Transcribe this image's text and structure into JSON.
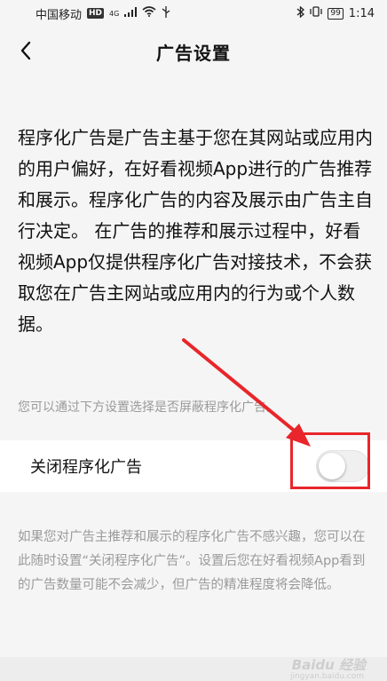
{
  "status_bar": {
    "carrier": "中国移动",
    "hd_badge": "HD",
    "network": "4G",
    "battery": "99",
    "time": "1:14"
  },
  "header": {
    "title": "广告设置"
  },
  "intro_text": "程序化广告是广告主基于您在其网站或应用内的用户偏好，在好看视频App进行的广告推荐和展示。程序化广告的内容及展示由广告主自行决定。 在广告的推荐和展示过程中，好看视频App仅提供程序化广告对接技术，不会获取您在广告主网站或应用内的行为或个人数据。",
  "hint_text": "您可以通过下方设置选择是否屏蔽程序化广告。",
  "toggle": {
    "label": "关闭程序化广告",
    "enabled": false
  },
  "description_text": "如果您对广告主推荐和展示的程序化广告不感兴趣，您可以在此随时设置“关闭程序化广告”。设置后您在好看视频App看到的广告数量可能不会减少，但广告的精准程度将会降低。",
  "watermark": {
    "brand": "Baidu 经验",
    "url": "jingyan.baidu.com"
  },
  "colors": {
    "annotation": "#e8262b",
    "background": "#f5f5f5",
    "hint_text": "#9a9a9a"
  }
}
